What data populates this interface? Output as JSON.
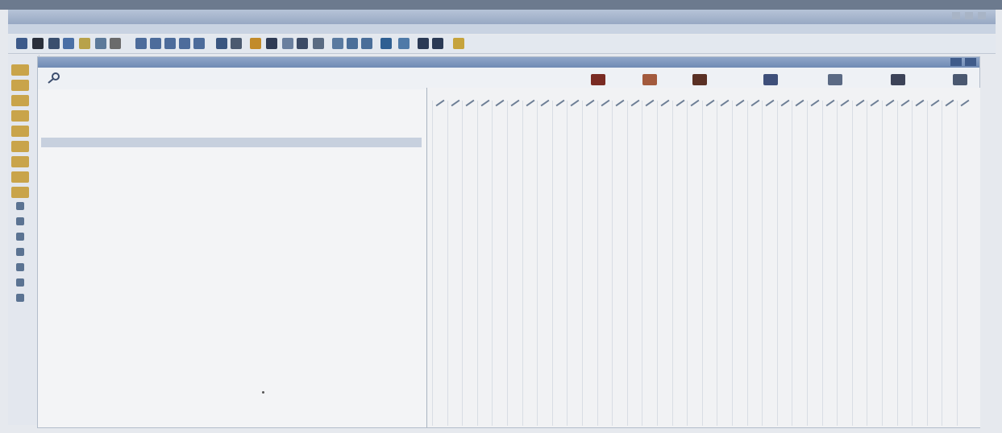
{
  "app": {
    "title": "",
    "menu": [
      "",
      "",
      "",
      "",
      "",
      "",
      ""
    ]
  },
  "document": {
    "title": ""
  },
  "filter": {
    "label": "",
    "value": ""
  },
  "people": [
    {
      "label": "",
      "color": "#7a2b23"
    },
    {
      "label": "",
      "color": "#a35a3d"
    },
    {
      "label": "",
      "color": "#5a3024"
    },
    {
      "label": "",
      "color": "#3e4f7a"
    },
    {
      "label": "",
      "color": "#5b6a84"
    },
    {
      "label": "",
      "color": "#3c4358"
    },
    {
      "label": "",
      "color": "#4a5870"
    }
  ],
  "leftPane": {
    "header": "",
    "headerRight": "",
    "rows": [
      {
        "label": "",
        "code": ""
      },
      {
        "label": "",
        "code": ""
      },
      {
        "label": "",
        "code": ""
      },
      {
        "label": "",
        "code": ""
      },
      {
        "label": "",
        "code": ""
      },
      {
        "label": "",
        "code": ""
      },
      {
        "label": "",
        "code": ""
      },
      {
        "label": "",
        "code": ""
      },
      {
        "label": "",
        "code": ""
      },
      {
        "label": "",
        "code": ""
      },
      {
        "label": "",
        "code": ""
      },
      {
        "label": "",
        "code": ""
      }
    ]
  },
  "toolbarIcons": [
    "new-icon",
    "binoculars-icon",
    "glasses-icon",
    "search-icon",
    "light-icon",
    "pencil-icon",
    "key-icon",
    "doc-icon",
    "doc-icon",
    "doc-icon",
    "doc-icon",
    "doc-icon",
    "bar-icon",
    "tree-icon",
    "warning-icon",
    "blob-icon",
    "refresh-icon",
    "chart-icon",
    "flag-icon",
    "doc-icon",
    "book-icon",
    "book-icon",
    "globe-icon",
    "folder-icon",
    "car-icon",
    "car-icon",
    "bulb-icon"
  ],
  "railIcons": [
    "folder-icon",
    "folder-icon",
    "folder-icon",
    "folder-icon",
    "folder-icon",
    "folder-icon",
    "folder-icon",
    "folder-icon",
    "folder-icon",
    "tool-icon",
    "tool-icon",
    "tool-icon",
    "tool-icon",
    "tool-icon",
    "tool-icon",
    "tool-icon"
  ],
  "rightPane": {
    "columns": 36
  }
}
